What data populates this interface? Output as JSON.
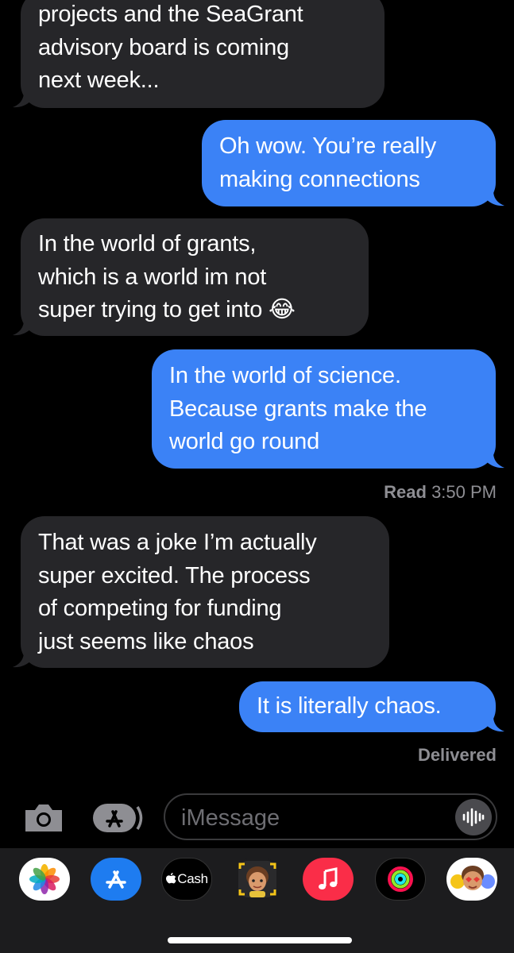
{
  "messages": [
    {
      "direction": "incoming",
      "lines": [
        "projects and the SeaGrant",
        "advisory board is coming",
        "next week..."
      ]
    },
    {
      "direction": "outgoing",
      "lines": [
        "Oh wow. You’re really",
        "making connections"
      ]
    },
    {
      "direction": "incoming",
      "lines": [
        "In the world of grants,",
        "which is a world im not",
        "super trying to get into 😂"
      ]
    },
    {
      "direction": "outgoing",
      "lines": [
        "In the world of science.",
        "Because grants make the",
        "world go round"
      ]
    },
    {
      "direction": "incoming",
      "lines": [
        "That was a joke I’m actually",
        "super excited. The process",
        "of competing for funding",
        "just seems like chaos"
      ]
    },
    {
      "direction": "outgoing",
      "lines": [
        "It is literally chaos."
      ]
    }
  ],
  "status": {
    "read_label": "Read",
    "read_time": "3:50 PM",
    "delivered": "Delivered"
  },
  "composer": {
    "placeholder": "iMessage",
    "camera_icon": "camera-icon",
    "apps_icon": "app-store-icon",
    "mic_icon": "audio-waveform-icon"
  },
  "app_drawer": {
    "apps": [
      {
        "name": "Photos",
        "icon": "photos-icon"
      },
      {
        "name": "App Store",
        "icon": "app-store-icon"
      },
      {
        "name": "Cash",
        "label": "Cash",
        "icon": "apple-cash-icon"
      },
      {
        "name": "Memoji",
        "icon": "memoji-icon"
      },
      {
        "name": "Music",
        "icon": "music-icon"
      },
      {
        "name": "Activity",
        "icon": "activity-rings-icon"
      },
      {
        "name": "Stickers",
        "icon": "memoji-stickers-icon"
      }
    ]
  },
  "colors": {
    "incoming_bubble": "#262629",
    "outgoing_bubble": "#3b82f6",
    "background": "#000000"
  }
}
